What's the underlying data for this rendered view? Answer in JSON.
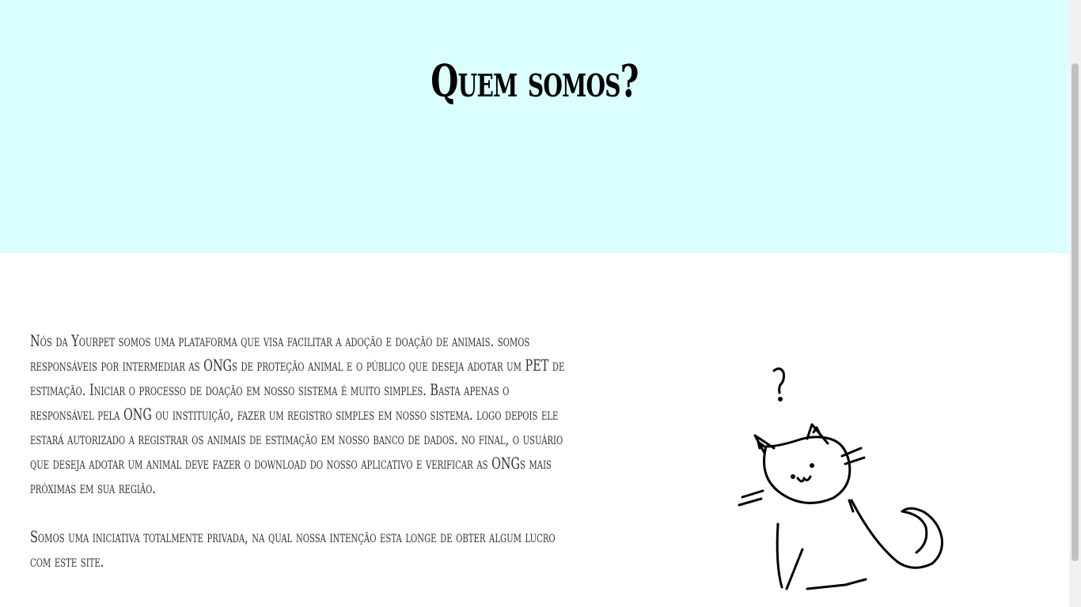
{
  "hero": {
    "title": "Quem somos?"
  },
  "about": {
    "paragraph1": "Nós da Yourpet somos uma plataforma que visa facilitar a adoção e doação de animais. somos responsáveis por intermediar as ONGs de proteção animal e o público que deseja adotar um PET de estimação. Iniciar o processo de doação em nosso sistema é muito simples. Basta apenas o responsável pela ONG ou instituição, fazer um registro simples em nosso sistema. logo depois ele estará autorizado a registrar os animais de estimação em nosso banco de dados. no final, o usuário que deseja adotar um animal deve fazer o download do nosso aplicativo e verificar as ONGs mais próximas em sua região.",
    "paragraph2": "Somos uma iniciativa totalmente privada, na qual nossa intenção esta longe de obter algum lucro com este site.",
    "illustration": "cat-with-question-mark-drawing"
  },
  "colors": {
    "hero_bg": "#dbffff",
    "text": "#333333",
    "title": "#000000"
  }
}
